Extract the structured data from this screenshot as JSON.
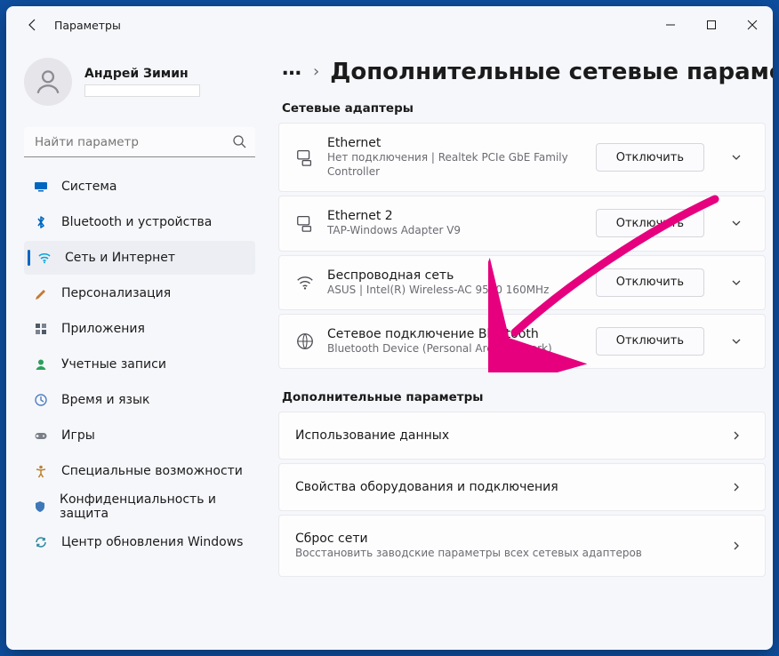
{
  "window": {
    "title": "Параметры"
  },
  "account": {
    "name": "Андрей Зимин"
  },
  "search": {
    "placeholder": "Найти параметр"
  },
  "nav": [
    {
      "key": "system",
      "label": "Система",
      "icon": "monitor",
      "color": "#0067c0"
    },
    {
      "key": "bluetooth",
      "label": "Bluetooth и устройства",
      "icon": "bluetooth",
      "color": "#0067c0"
    },
    {
      "key": "network",
      "label": "Сеть и Интернет",
      "icon": "wifi",
      "color": "#0aa3d9",
      "selected": true
    },
    {
      "key": "personalization",
      "label": "Персонализация",
      "icon": "brush",
      "color": "#c47b2e"
    },
    {
      "key": "apps",
      "label": "Приложения",
      "icon": "apps",
      "color": "#4e5a67"
    },
    {
      "key": "accounts",
      "label": "Учетные записи",
      "icon": "person",
      "color": "#2aa05a"
    },
    {
      "key": "time",
      "label": "Время и язык",
      "icon": "clock-globe",
      "color": "#4f7ec2"
    },
    {
      "key": "games",
      "label": "Игры",
      "icon": "gamepad",
      "color": "#7a7f87"
    },
    {
      "key": "accessibility",
      "label": "Специальные возможности",
      "icon": "accessibility",
      "color": "#b8832f"
    },
    {
      "key": "privacy",
      "label": "Конфиденциальность и защита",
      "icon": "shield",
      "color": "#3e78b8"
    },
    {
      "key": "update",
      "label": "Центр обновления Windows",
      "icon": "update",
      "color": "#2f8a9e"
    }
  ],
  "crumb": {
    "dots": "…",
    "sep": "›",
    "title": "Дополнительные сетевые параметры"
  },
  "sections": {
    "adapters": "Сетевые адаптеры",
    "advanced": "Дополнительные параметры"
  },
  "adapters": [
    {
      "title": "Ethernet",
      "desc": "Нет подключения | Realtek PCIe GbE Family Controller",
      "button": "Отключить",
      "icon": "eth"
    },
    {
      "title": "Ethernet 2",
      "desc": "TAP-Windows Adapter V9",
      "button": "Отключить",
      "icon": "eth"
    },
    {
      "title": "Беспроводная сеть",
      "desc": "ASUS | Intel(R) Wireless-AC 9560 160MHz",
      "button": "Отключить",
      "icon": "wifi"
    },
    {
      "title": "Сетевое подключение Bluetooth",
      "desc": "Bluetooth Device (Personal Area Network)",
      "button": "Отключить",
      "icon": "btnet"
    }
  ],
  "advanced": [
    {
      "title": "Использование данных",
      "desc": ""
    },
    {
      "title": "Свойства оборудования и подключения",
      "desc": ""
    },
    {
      "title": "Сброс сети",
      "desc": "Восстановить заводские параметры всех сетевых адаптеров"
    }
  ]
}
